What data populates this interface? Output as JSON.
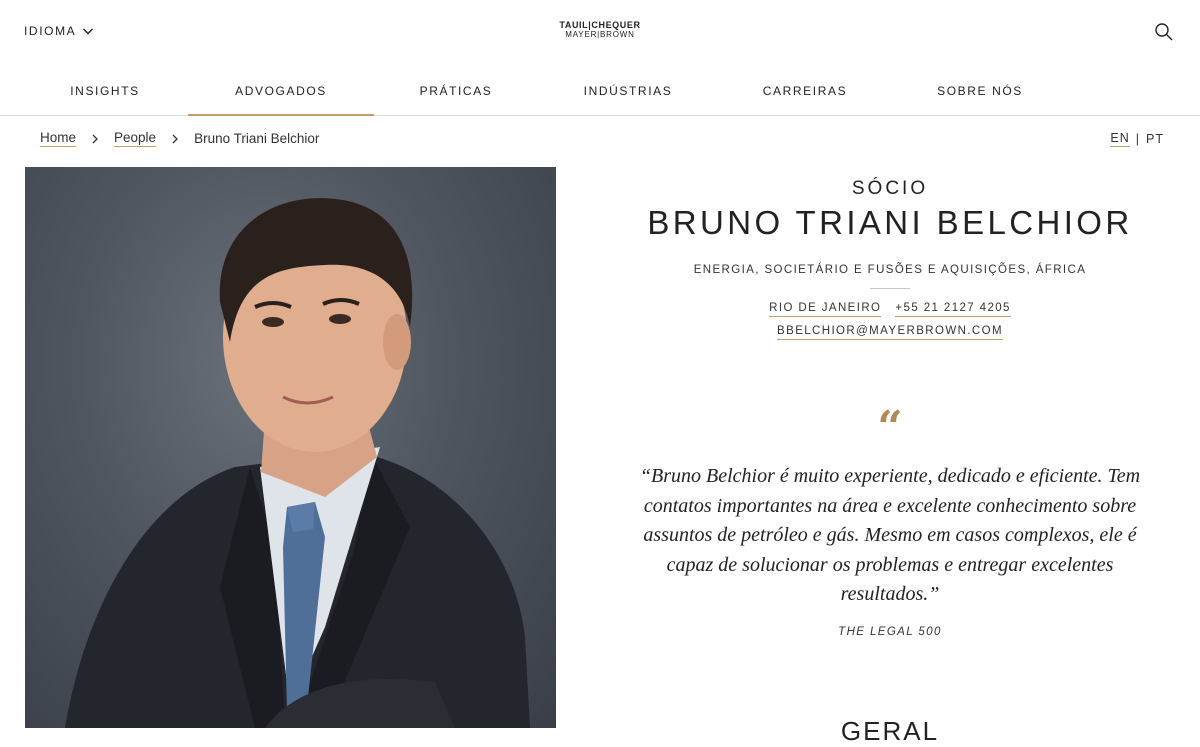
{
  "header": {
    "language_label": "IDIOMA",
    "logo_line1": "TAUIL|CHEQUER",
    "logo_line2": "MAYER|BROWN"
  },
  "nav": {
    "items": [
      {
        "label": "INSIGHTS"
      },
      {
        "label": "ADVOGADOS",
        "active": true
      },
      {
        "label": "PRÁTICAS"
      },
      {
        "label": "INDÚSTRIAS"
      },
      {
        "label": "CARREIRAS"
      },
      {
        "label": "SOBRE NÓS"
      }
    ]
  },
  "breadcrumb": {
    "home": "Home",
    "people": "People",
    "current": "Bruno Triani Belchior"
  },
  "lang_switch": {
    "en": "EN",
    "separator": "|",
    "pt": "PT"
  },
  "profile": {
    "role": "SÓCIO",
    "name": "BRUNO TRIANI BELCHIOR",
    "practices": "ENERGIA, SOCIETÁRIO E FUSÕES E AQUISIÇÕES, ÁFRICA",
    "city": "RIO DE JANEIRO",
    "phone": "+55 21 2127 4205",
    "email": "BBELCHIOR@MAYERBROWN.COM"
  },
  "quote": {
    "mark": "“",
    "text": "“Bruno Belchior é muito experiente, dedicado e eficiente. Tem contatos importantes na área e excelente conhecimento sobre assuntos de petróleo e gás. Mesmo em casos complexos, ele é capaz de solucionar os problemas e entregar excelentes resultados.”",
    "source": "THE LEGAL 500"
  },
  "section": {
    "title": "GERAL"
  },
  "colors": {
    "accent": "#c29e6c",
    "quote_mark": "#b08a57",
    "portrait_bg": "#4f565f"
  }
}
